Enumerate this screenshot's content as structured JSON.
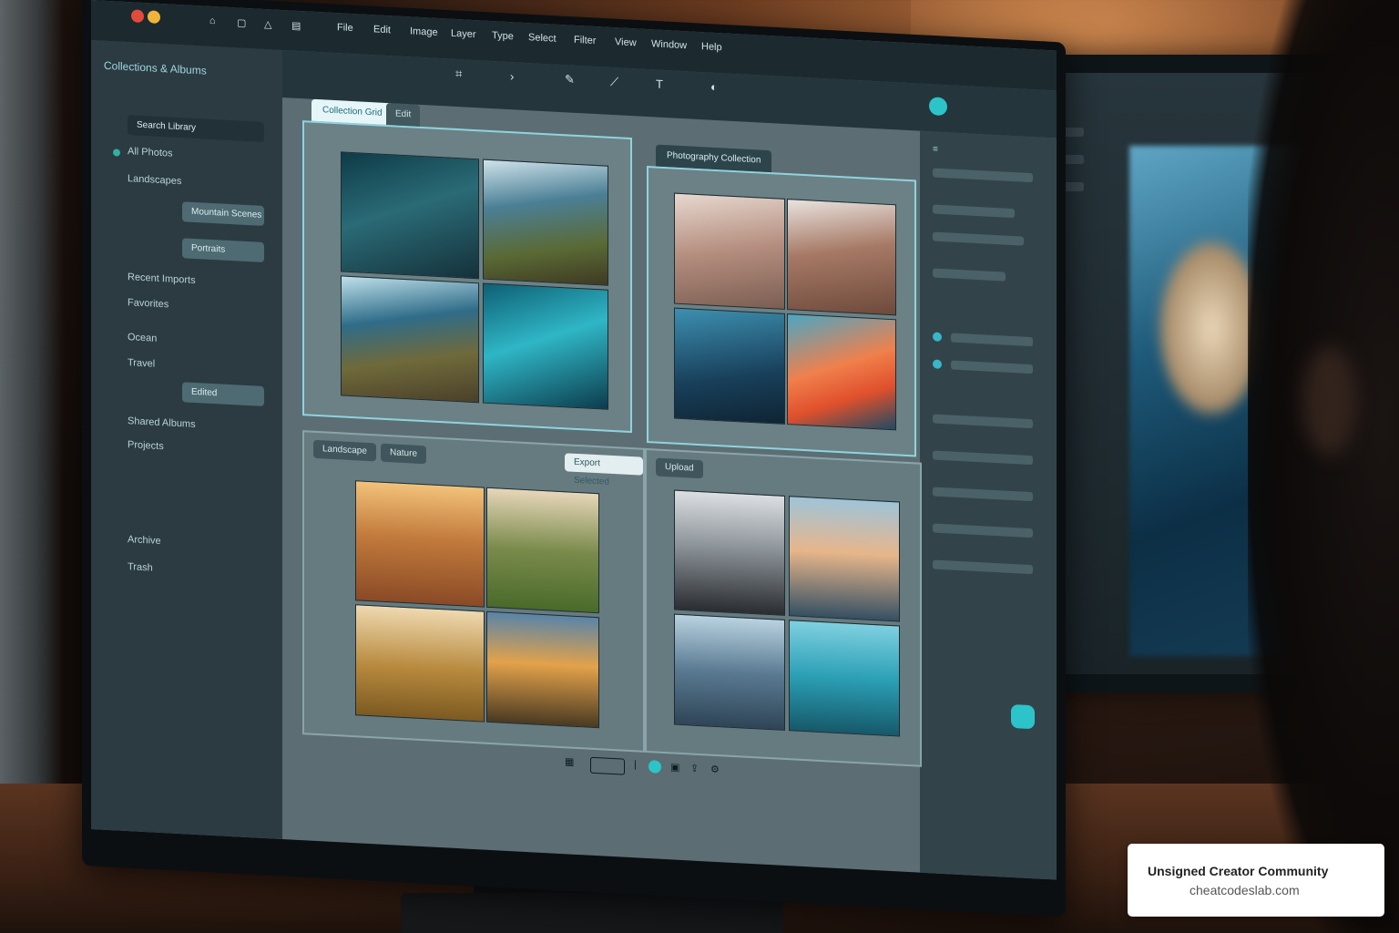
{
  "menu": {
    "items": [
      "File",
      "Edit",
      "Image",
      "Layer",
      "Type",
      "Select",
      "Filter",
      "View",
      "Window",
      "Help"
    ]
  },
  "toolbar": {
    "tools": [
      "crop-icon",
      "move-icon",
      "brush-icon",
      "pen-icon",
      "text-icon",
      "layers-icon"
    ]
  },
  "sidebar": {
    "title": "Collections & Albums",
    "search_placeholder": "Search Library",
    "items": [
      "All Photos",
      "Landscapes",
      "Mountain Scenes",
      "Portraits",
      "Recent Imports",
      "Favorites",
      "Ocean",
      "Travel",
      "Edited",
      "Shared Albums",
      "Projects",
      "Archive",
      "Trash"
    ]
  },
  "panels": {
    "p1_tab": "Collection Grid",
    "p1_tab2": "Edit",
    "p2_tab": "Photography Collection",
    "p3_tab1": "Landscape",
    "p3_tab2": "Nature",
    "p3_pill": "Export Selected",
    "p4_pill": "Upload"
  },
  "watermark": {
    "title": "Unsigned Creator Community",
    "url": "cheatcodeslab.com"
  },
  "colors": {
    "accent": "#8fd3de",
    "teal": "#2cc4c9",
    "screen_bg": "#5c6e73"
  }
}
